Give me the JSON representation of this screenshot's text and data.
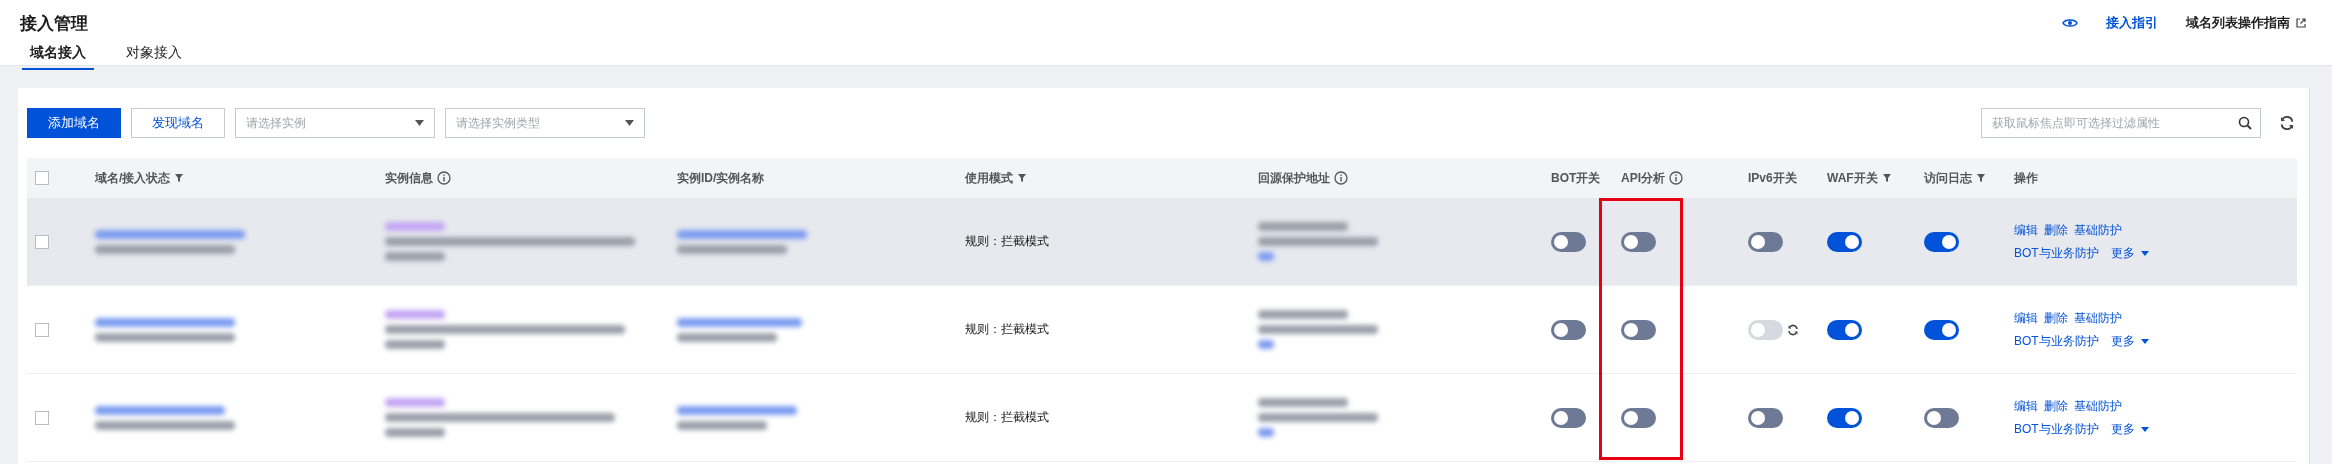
{
  "page": {
    "title": "接入管理"
  },
  "tabs": [
    {
      "label": "域名接入",
      "selected": true
    },
    {
      "label": "对象接入",
      "selected": false
    }
  ],
  "header_links": [
    {
      "kind": "guide",
      "label": "接入指引"
    },
    {
      "kind": "external",
      "label": "域名列表操作指南"
    }
  ],
  "toolbar": {
    "buttons": [
      {
        "label": "添加域名",
        "kind": "primary"
      },
      {
        "label": "发现域名",
        "kind": "secondary"
      }
    ],
    "selects": [
      {
        "placeholder": "请选择实例"
      },
      {
        "placeholder": "请选择实例类型"
      }
    ],
    "search": {
      "placeholder": "获取鼠标焦点即可选择过滤属性"
    }
  },
  "table": {
    "select_all": {
      "checked": false
    },
    "columns": [
      {
        "label": "域名/接入状态",
        "kind": "filter",
        "highlighted": false
      },
      {
        "label": "实例信息",
        "kind": "info",
        "highlighted": false
      },
      {
        "label": "实例ID/实例名称",
        "kind": "plain",
        "highlighted": false
      },
      {
        "label": "使用模式",
        "kind": "filter",
        "highlighted": false
      },
      {
        "label": "回源保护地址",
        "kind": "info",
        "highlighted": false
      },
      {
        "label": "BOT开关",
        "kind": "plain",
        "highlighted": false
      },
      {
        "label": "API分析",
        "kind": "info",
        "highlighted": true
      },
      {
        "label": "IPv6开关",
        "kind": "plain",
        "highlighted": false
      },
      {
        "label": "WAF开关",
        "kind": "filter",
        "highlighted": false
      },
      {
        "label": "访问日志",
        "kind": "filter",
        "highlighted": false
      },
      {
        "label": "操作",
        "kind": "plain",
        "highlighted": false
      }
    ],
    "rows": [
      {
        "checked": false,
        "hovered": true,
        "mode": "规则：拦截模式",
        "bot": {
          "on": false,
          "disabled": false
        },
        "api": {
          "on": false,
          "disabled": false
        },
        "ipv6": {
          "on": false,
          "disabled": false
        },
        "waf": {
          "on": true,
          "disabled": false
        },
        "log": {
          "on": true,
          "disabled": false
        },
        "actions": [
          "编辑",
          "删除",
          "基础防护"
        ],
        "actions_2": [
          "BOT与业务防护",
          "更多"
        ]
      },
      {
        "checked": false,
        "hovered": false,
        "mode": "规则：拦截模式",
        "bot": {
          "on": false,
          "disabled": false
        },
        "api": {
          "on": false,
          "disabled": false
        },
        "ipv6": {
          "on": false,
          "disabled": true
        },
        "waf": {
          "on": true,
          "disabled": false
        },
        "log": {
          "on": true,
          "disabled": false
        },
        "actions": [
          "编辑",
          "删除",
          "基础防护"
        ],
        "actions_2": [
          "BOT与业务防护",
          "更多"
        ]
      },
      {
        "checked": false,
        "hovered": false,
        "mode": "规则：拦截模式",
        "bot": {
          "on": false,
          "disabled": false
        },
        "api": {
          "on": false,
          "disabled": false
        },
        "ipv6": {
          "on": false,
          "disabled": false
        },
        "waf": {
          "on": true,
          "disabled": false
        },
        "log": {
          "on": false,
          "disabled": false
        },
        "actions": [
          "编辑",
          "删除",
          "基础防护"
        ],
        "actions_2": [
          "BOT与业务防护",
          "更多"
        ]
      }
    ]
  }
}
